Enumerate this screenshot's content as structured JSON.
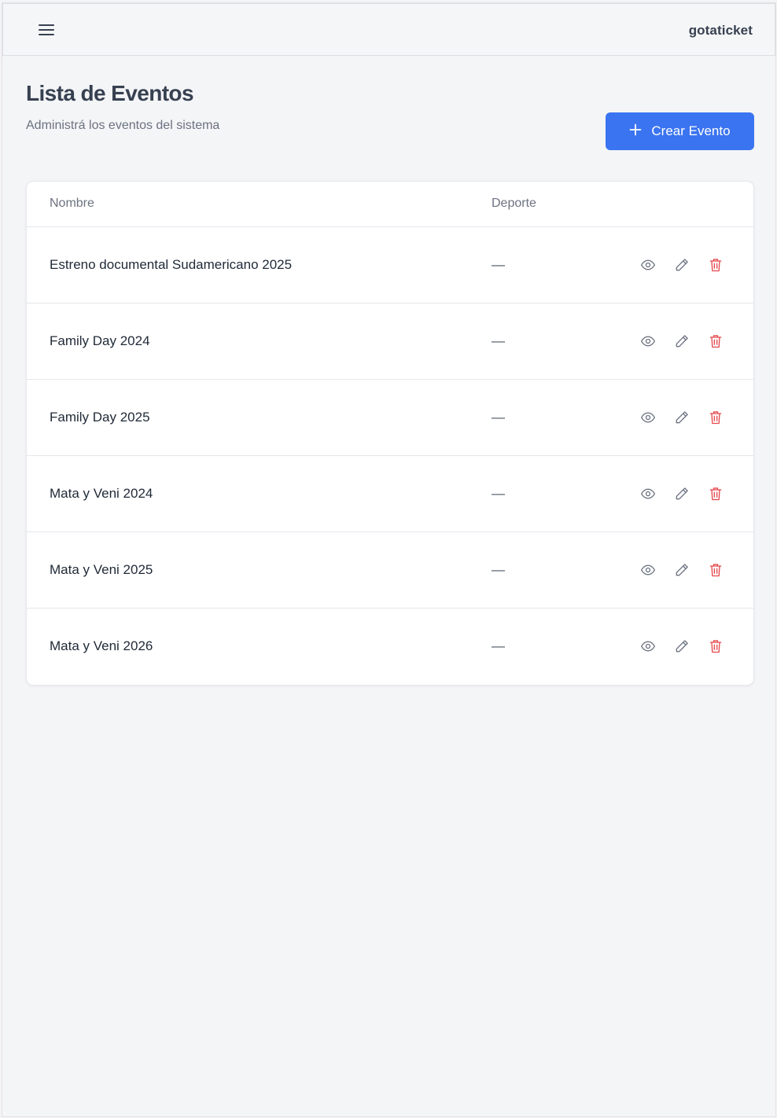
{
  "header": {
    "menu_icon": "hamburger-icon",
    "brand": "gotaticket"
  },
  "page": {
    "title": "Lista de Eventos",
    "subtitle": "Administrá los eventos del sistema",
    "create_button": {
      "icon": "plus-icon",
      "label": "Crear Evento"
    }
  },
  "table": {
    "columns": [
      "Nombre",
      "Deporte"
    ],
    "rows": [
      {
        "name": "Estreno documental Sudamericano 2025",
        "sport": "—"
      },
      {
        "name": "Family Day 2024",
        "sport": "—"
      },
      {
        "name": "Family Day 2025",
        "sport": "—"
      },
      {
        "name": "Mata y Veni 2024",
        "sport": "—"
      },
      {
        "name": "Mata y Veni 2025",
        "sport": "—"
      },
      {
        "name": "Mata y Veni 2026",
        "sport": "—"
      }
    ],
    "row_actions": [
      "eye-icon",
      "pencil-icon",
      "trash-icon"
    ]
  },
  "colors": {
    "accent": "#3b74f0",
    "danger": "#e5484d",
    "icon_gray": "#6b7280",
    "background": "#f4f5f7"
  }
}
